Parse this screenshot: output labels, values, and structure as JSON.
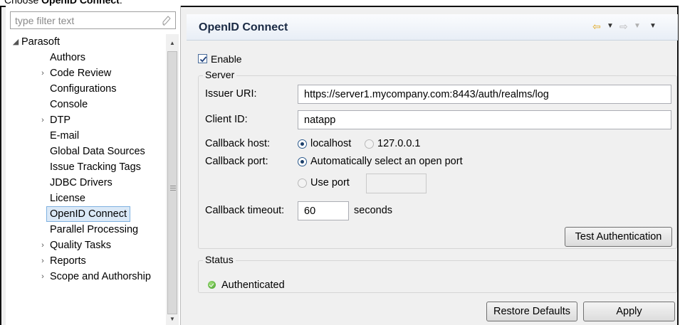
{
  "caption": {
    "prefix": "Choose ",
    "bold": "OpenID Connect",
    "suffix": "."
  },
  "filter": {
    "placeholder": "type filter text"
  },
  "tree": {
    "root": "Parasoft",
    "items": [
      {
        "label": "Authors",
        "expandable": false
      },
      {
        "label": "Code Review",
        "expandable": true
      },
      {
        "label": "Configurations",
        "expandable": false
      },
      {
        "label": "Console",
        "expandable": false
      },
      {
        "label": "DTP",
        "expandable": true
      },
      {
        "label": "E-mail",
        "expandable": false
      },
      {
        "label": "Global Data Sources",
        "expandable": false
      },
      {
        "label": "Issue Tracking Tags",
        "expandable": false
      },
      {
        "label": "JDBC Drivers",
        "expandable": false
      },
      {
        "label": "License",
        "expandable": false
      },
      {
        "label": "OpenID Connect",
        "expandable": false,
        "selected": true
      },
      {
        "label": "Parallel Processing",
        "expandable": false
      },
      {
        "label": "Quality Tasks",
        "expandable": true
      },
      {
        "label": "Reports",
        "expandable": true
      },
      {
        "label": "Scope and Authorship",
        "expandable": true
      }
    ]
  },
  "page": {
    "title": "OpenID Connect",
    "enable_label": "Enable",
    "enable_checked": true,
    "server": {
      "title": "Server",
      "issuer_label": "Issuer URI:",
      "issuer_value": "https://server1.mycompany.com:8443/auth/realms/log",
      "client_label": "Client ID:",
      "client_value": "natapp",
      "callback_host_label": "Callback host:",
      "callback_host_options": [
        "localhost",
        "127.0.0.1"
      ],
      "callback_host_selected": "localhost",
      "callback_port_label": "Callback port:",
      "callback_port_auto": "Automatically select an open port",
      "callback_port_use": "Use port",
      "callback_port_value": "",
      "timeout_label": "Callback timeout:",
      "timeout_value": "60",
      "timeout_unit": "seconds",
      "test_button": "Test Authentication"
    },
    "status": {
      "title": "Status",
      "text": "Authenticated",
      "color": "#3e9a23"
    },
    "restore_button": "Restore Defaults",
    "apply_button": "Apply"
  },
  "nav_icons": [
    "back-arrow-icon",
    "dropdown-icon",
    "forward-arrow-icon",
    "dropdown-icon",
    "view-menu-icon"
  ]
}
